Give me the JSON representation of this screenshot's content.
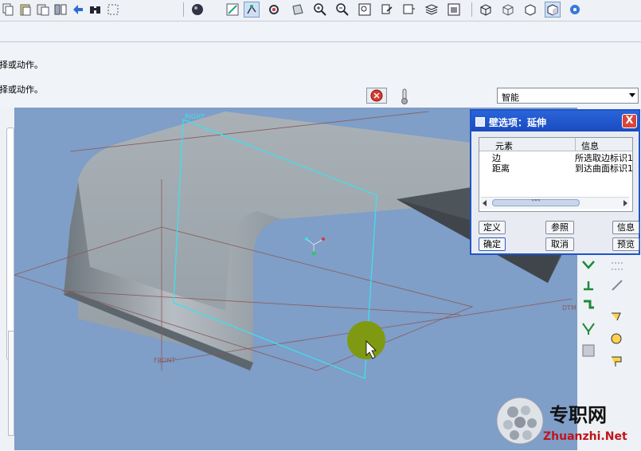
{
  "toolbar": {
    "icons": [
      "copy-icon",
      "paste-icon",
      "paste-special-icon",
      "mirror-icon",
      "regenerate-icon",
      "find-icon",
      "select-box-icon",
      "shade-sphere-icon",
      "sketch-icon",
      "edge-node-icon",
      "setup-icon",
      "orient-icon",
      "zoom-in-icon",
      "zoom-out-icon",
      "refit-icon",
      "reorient-icon",
      "saved-views-icon",
      "layers-icon",
      "view-manager-icon",
      "wireframe-icon",
      "hidden-line-icon",
      "no-hidden-icon",
      "shading-icon",
      "datum-display-icon"
    ]
  },
  "messages": {
    "line1": "选择或动作。",
    "line2": "选择或动作。"
  },
  "filter": {
    "value": "智能"
  },
  "viewport": {
    "label_right": "RIGHT",
    "label_front": "FRONT",
    "label_dtm": "DTM"
  },
  "dialog": {
    "title": "壁选项：延伸",
    "close_label": "X",
    "columns": [
      "元素",
      "信息"
    ],
    "rows": [
      {
        "element": "边",
        "info": "所选取边标识1"
      },
      {
        "element": "距离",
        "info": "到达曲面标识1"
      }
    ],
    "scroll_thumb": "\"\"\"",
    "buttons": {
      "define": "定义",
      "refs": "参照",
      "info": "信息",
      "ok": "确定",
      "cancel": "取消",
      "preview": "预览"
    }
  },
  "watermark": {
    "cn": "专职网",
    "url": "Zhuanzhi.Net"
  },
  "colors": {
    "viewport_bg": "#7f9ec8",
    "part_gray": "#8c959c",
    "datum_cyan": "#3fe0ea",
    "dialog_title": "#1f54c8",
    "watermark_red": "#c0141c"
  }
}
